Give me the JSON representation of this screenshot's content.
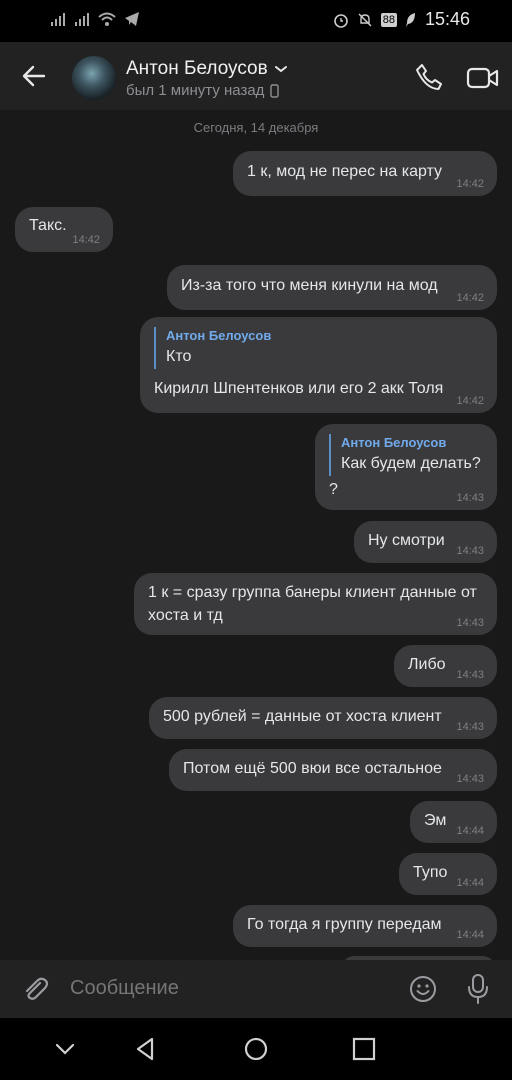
{
  "status_bar": {
    "time": "15:46",
    "battery": "88"
  },
  "header": {
    "contact_name": "Антон Белоусов",
    "contact_status": "был 1 минуту назад"
  },
  "chat": {
    "date_separator": "Сегодня, 14 декабря",
    "messages": [
      {
        "text": "1 к, мод не перес на карту",
        "time": "14:42",
        "direction": "out"
      },
      {
        "text": "Такс.",
        "time": "14:42",
        "direction": "in"
      },
      {
        "text": "Из-за того что меня кинули на мод",
        "time": "14:42",
        "direction": "out"
      },
      {
        "quote_author": "Антон Белоусов",
        "quote_text": "Кто",
        "text": "Кирилл Шпентенков или его 2 акк Толя",
        "time": "14:42",
        "direction": "out"
      },
      {
        "quote_author": "Антон Белоусов",
        "quote_text": "Как будем делать?",
        "text": "?",
        "time": "14:43",
        "direction": "out"
      },
      {
        "text": "Ну смотри",
        "time": "14:43",
        "direction": "out"
      },
      {
        "text_line1": "1 к = сразу группа банеры клиент данные от",
        "text_line2": "хоста и тд",
        "time": "14:43",
        "direction": "out"
      },
      {
        "text": "Либо",
        "time": "14:43",
        "direction": "out"
      },
      {
        "text": "500 рублей = данные от хоста клиент",
        "time": "14:43",
        "direction": "out"
      },
      {
        "text": "Потом ещё 500 вюи все остальное",
        "time": "14:43",
        "direction": "out"
      },
      {
        "text": "Эм",
        "time": "14:44",
        "direction": "out"
      },
      {
        "text": "Тупо",
        "time": "14:44",
        "direction": "out"
      },
      {
        "text": "Го тогда я группу передам",
        "time": "14:44",
        "direction": "out"
      }
    ]
  },
  "composer": {
    "placeholder": "Сообщение"
  },
  "icons": {
    "back": "arrow-left",
    "call": "phone",
    "video": "video-camera",
    "attach": "paperclip",
    "emoji": "smiley",
    "voice": "microphone",
    "nav": [
      "chevron-down",
      "triangle-back",
      "circle-home",
      "square-recents"
    ]
  },
  "colors": {
    "background": "#19191a",
    "bubble": "#3a3a3c",
    "accent": "#71aaeb",
    "quote_bar": "#5c8fc6"
  }
}
